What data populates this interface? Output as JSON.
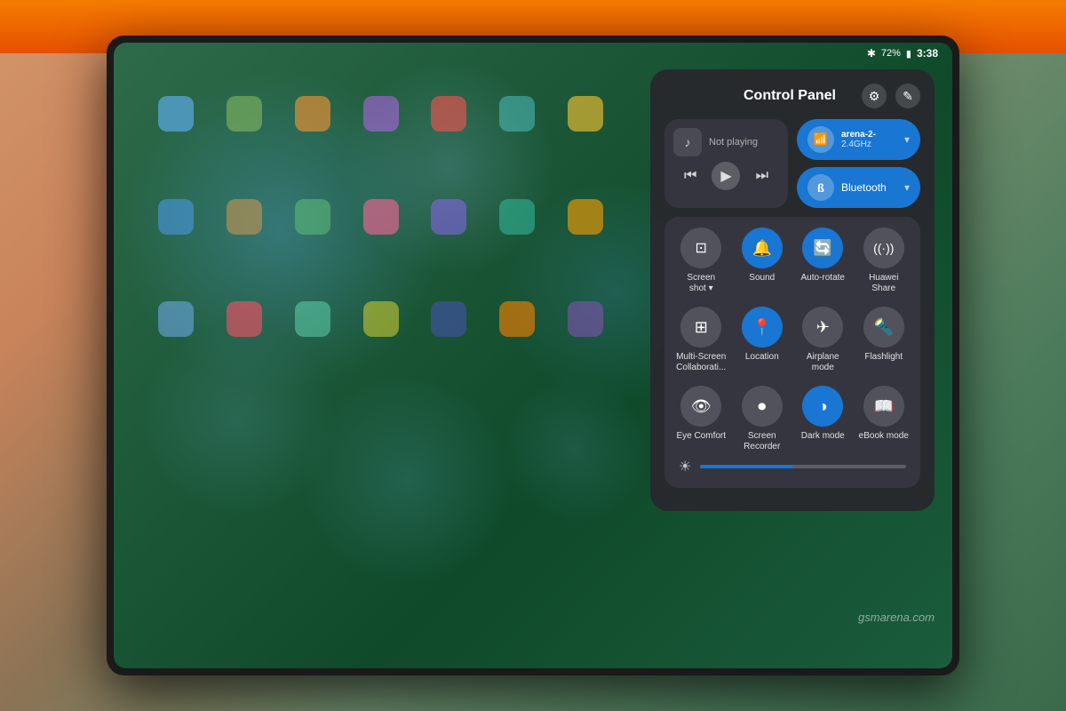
{
  "background": {
    "color": "#c8835a"
  },
  "status_bar": {
    "bluetooth_icon": "✱",
    "battery_percent": "72%",
    "battery_icon": "🔋",
    "time": "3:38"
  },
  "control_panel": {
    "title": "Control Panel",
    "settings_icon": "⚙",
    "edit_icon": "✎",
    "media_player": {
      "music_icon": "♪",
      "not_playing_label": "Not playing",
      "prev_icon": "⏮",
      "play_icon": "▶",
      "next_icon": "⏭"
    },
    "wifi": {
      "label": "arena-2-\n2.4GHz",
      "icon": "📶",
      "chevron": "▾",
      "active": true
    },
    "bluetooth": {
      "label": "Bluetooth",
      "icon": "✱",
      "chevron": "▾",
      "active": true
    },
    "toggles": [
      {
        "id": "screenshot",
        "icon": "⬜",
        "label": "Screen\nshot ▾",
        "active": false
      },
      {
        "id": "sound",
        "icon": "🔔",
        "label": "Sound",
        "active": true
      },
      {
        "id": "auto-rotate",
        "icon": "🔄",
        "label": "Auto-rotate",
        "active": true
      },
      {
        "id": "huawei-share",
        "icon": "((·))",
        "label": "Huawei\nShare",
        "active": false
      },
      {
        "id": "multiscreen",
        "icon": "⊞",
        "label": "Multi-Screen\nCollaborati...",
        "active": false
      },
      {
        "id": "location",
        "icon": "📍",
        "label": "Location",
        "active": true
      },
      {
        "id": "airplane",
        "icon": "✈",
        "label": "Airplane\nmode",
        "active": false
      },
      {
        "id": "flashlight",
        "icon": "🔦",
        "label": "Flashlight",
        "active": false
      },
      {
        "id": "eye-comfort",
        "icon": "👁",
        "label": "Eye Comfort",
        "active": false
      },
      {
        "id": "screen-recorder",
        "icon": "⏺",
        "label": "Screen\nRecorder",
        "active": false
      },
      {
        "id": "dark-mode",
        "icon": "◑",
        "label": "Dark mode",
        "active": true
      },
      {
        "id": "ebook-mode",
        "icon": "📖",
        "label": "eBook mode",
        "active": false
      }
    ],
    "brightness": {
      "icon": "☀",
      "value": 45
    }
  },
  "watermark": {
    "text": "gsmarena.com"
  }
}
